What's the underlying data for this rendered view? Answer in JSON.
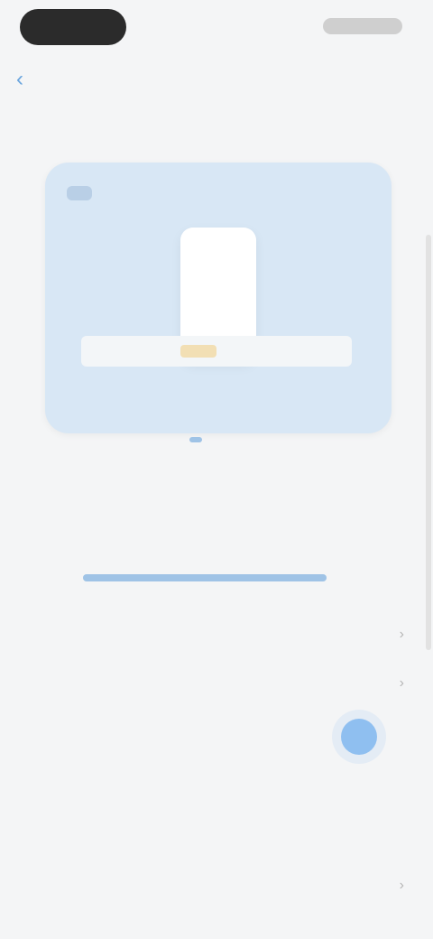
{
  "header": {
    "back_symbol": "‹",
    "title": "",
    "action": ""
  },
  "section": {
    "label": ""
  },
  "preview": {
    "badge": "",
    "card_title": "",
    "card_subtitle": ""
  },
  "slider": {
    "left_label": "",
    "right_label": "",
    "level": 1.0
  },
  "rows": [
    {
      "label": "",
      "value": "",
      "chevron": "›"
    },
    {
      "label": "",
      "value": "",
      "chevron": "›"
    },
    {
      "label": "",
      "value": "",
      "chevron": ""
    },
    {
      "label": "",
      "value": "",
      "chevron": ""
    },
    {
      "label": "",
      "value": "",
      "chevron": ""
    },
    {
      "label": "",
      "value": "",
      "chevron": "›"
    }
  ],
  "colors": {
    "accent": "#6aa5de",
    "card_bg": "#d8e7f5",
    "toggle": "#8fbff0"
  },
  "icons": {
    "back": "chevron-left-icon",
    "row_chevron": "chevron-right-icon"
  }
}
